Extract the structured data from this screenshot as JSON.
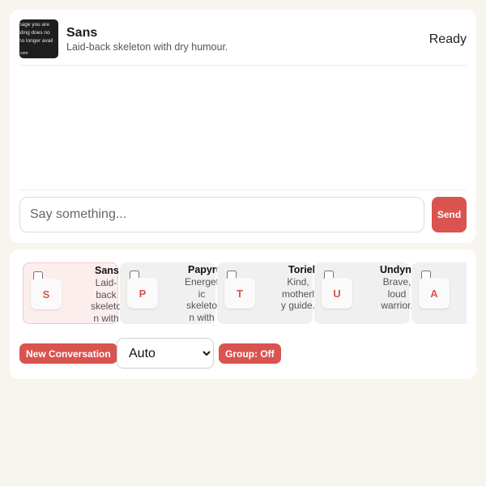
{
  "chat": {
    "character": {
      "name": "Sans",
      "description": "Laid-back skeleton with dry humour.",
      "avatar_text": [
        "nage you are",
        "sting does no",
        "no longer avail",
        "com"
      ]
    },
    "status": "Ready",
    "input": {
      "placeholder": "Say something...",
      "value": ""
    },
    "send_label": "Send"
  },
  "characters": [
    {
      "initial": "S",
      "name": "Sans",
      "description": "Laid-back skeleton with dry humour.",
      "selected": true
    },
    {
      "initial": "P",
      "name": "Papyrus",
      "description": "Energetic skeleton with grand ambitions.",
      "selected": false
    },
    {
      "initial": "T",
      "name": "Toriel",
      "description": "Kind, motherly guide.",
      "selected": false
    },
    {
      "initial": "U",
      "name": "Undyne",
      "description": "Brave, loud warrior.",
      "selected": false
    },
    {
      "initial": "A",
      "name": "",
      "description": "",
      "selected": false
    }
  ],
  "controls": {
    "new_conversation_label": "New Conversation",
    "mode": {
      "selected": "Auto",
      "options": [
        "Auto"
      ]
    },
    "group_label": "Group: Off"
  },
  "colors": {
    "accent": "#d9534f",
    "background": "#f8f5ee",
    "card": "#ffffff",
    "character_card": "#f0f0f0",
    "character_card_selected": "#fdeeee"
  }
}
